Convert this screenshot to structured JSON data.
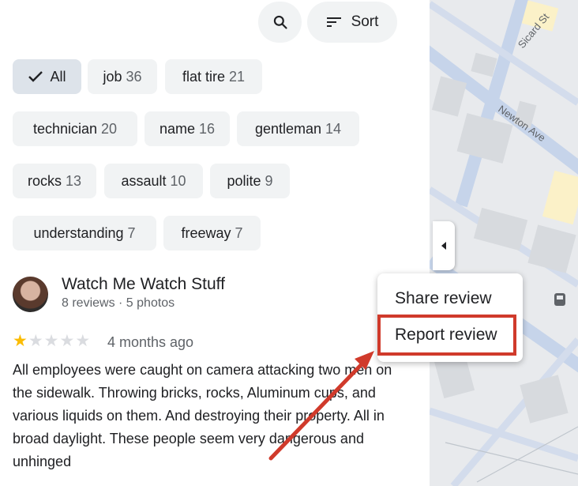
{
  "actions": {
    "sort_label": "Sort"
  },
  "chips": [
    {
      "label": "All",
      "count": "",
      "selected": true
    },
    {
      "label": "job",
      "count": "36"
    },
    {
      "label": "flat tire",
      "count": "21"
    },
    {
      "label": "technician",
      "count": "20"
    },
    {
      "label": "name",
      "count": "16"
    },
    {
      "label": "gentleman",
      "count": "14"
    },
    {
      "label": "rocks",
      "count": "13"
    },
    {
      "label": "assault",
      "count": "10"
    },
    {
      "label": "polite",
      "count": "9"
    },
    {
      "label": "understanding",
      "count": "7"
    },
    {
      "label": "freeway",
      "count": "7"
    }
  ],
  "review": {
    "reviewer_name": "Watch Me Watch Stuff",
    "reviewer_meta": "8 reviews · 5 photos",
    "rating": 1,
    "rating_max": 5,
    "date": "4 months ago",
    "text": "All employees were caught on camera attacking two men on the sidewalk. Throwing bricks, rocks, Aluminum cups, and various liquids on them. And destroying their property. All in broad daylight. These people seem very dangerous and unhinged"
  },
  "menu": {
    "share_label": "Share review",
    "report_label": "Report review"
  },
  "map": {
    "street_1": "Sicard St",
    "street_2": "Newton Ave"
  },
  "colors": {
    "accent_red": "#d03a2b",
    "star": "#fbbc04",
    "chip_bg": "#f1f3f4",
    "chip_selected": "#dde3ea"
  }
}
